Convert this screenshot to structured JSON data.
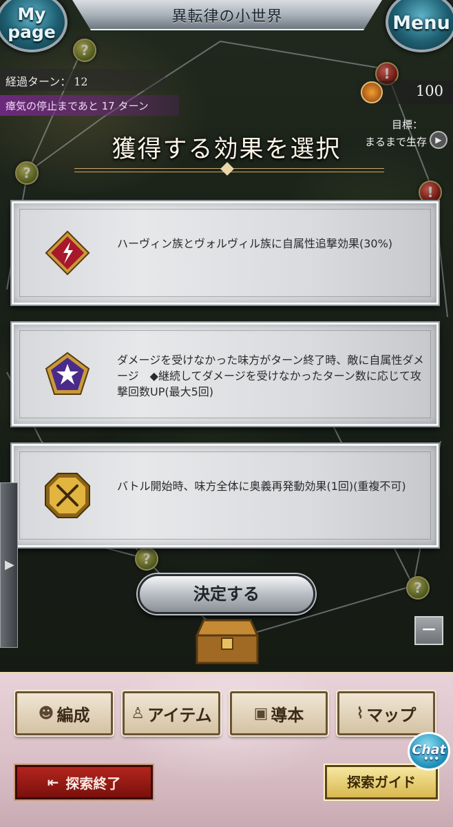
{
  "header": {
    "title": "異転律の小世界",
    "mypage_label": "My page",
    "menu_label": "Menu"
  },
  "status": {
    "turn_label": "経過ターン：",
    "turn_value": "12",
    "miasma_text": "瘴気の停止まであと 17 ターン",
    "points_value": "100",
    "goal_label": "目標：",
    "goal_text": "まるまで生存"
  },
  "selection": {
    "title": "獲得する効果を選択",
    "effects": [
      {
        "icon": "red-lightning-badge-icon",
        "text": "ハーヴィン族とヴォルヴィル族に自属性追撃効果(30%)"
      },
      {
        "icon": "purple-star-pentagon-icon",
        "text": "ダメージを受けなかった味方がターン終了時、敵に自属性ダメージ　◆継続してダメージを受けなかったターン数に応じて攻撃回数UP(最大5回)"
      },
      {
        "icon": "gold-crossed-swords-icon",
        "text": "バトル開始時、味方全体に奥義再発動効果(1回)(重複不可)"
      }
    ],
    "decide_label": "決定する"
  },
  "bottom_menu": {
    "formation_label": "編成",
    "item_label": "アイテム",
    "guide_book_label": "導本",
    "map_label": "マップ",
    "end_label": "探索終了",
    "explore_guide_label": "探索ガイド",
    "chat_label": "Chat",
    "chat_dots": "•••"
  },
  "colors": {
    "miasma_purple": "#782c8c",
    "end_red": "#b2251e",
    "guide_gold": "#d8b850",
    "mypage_teal": "#1e5f72"
  }
}
